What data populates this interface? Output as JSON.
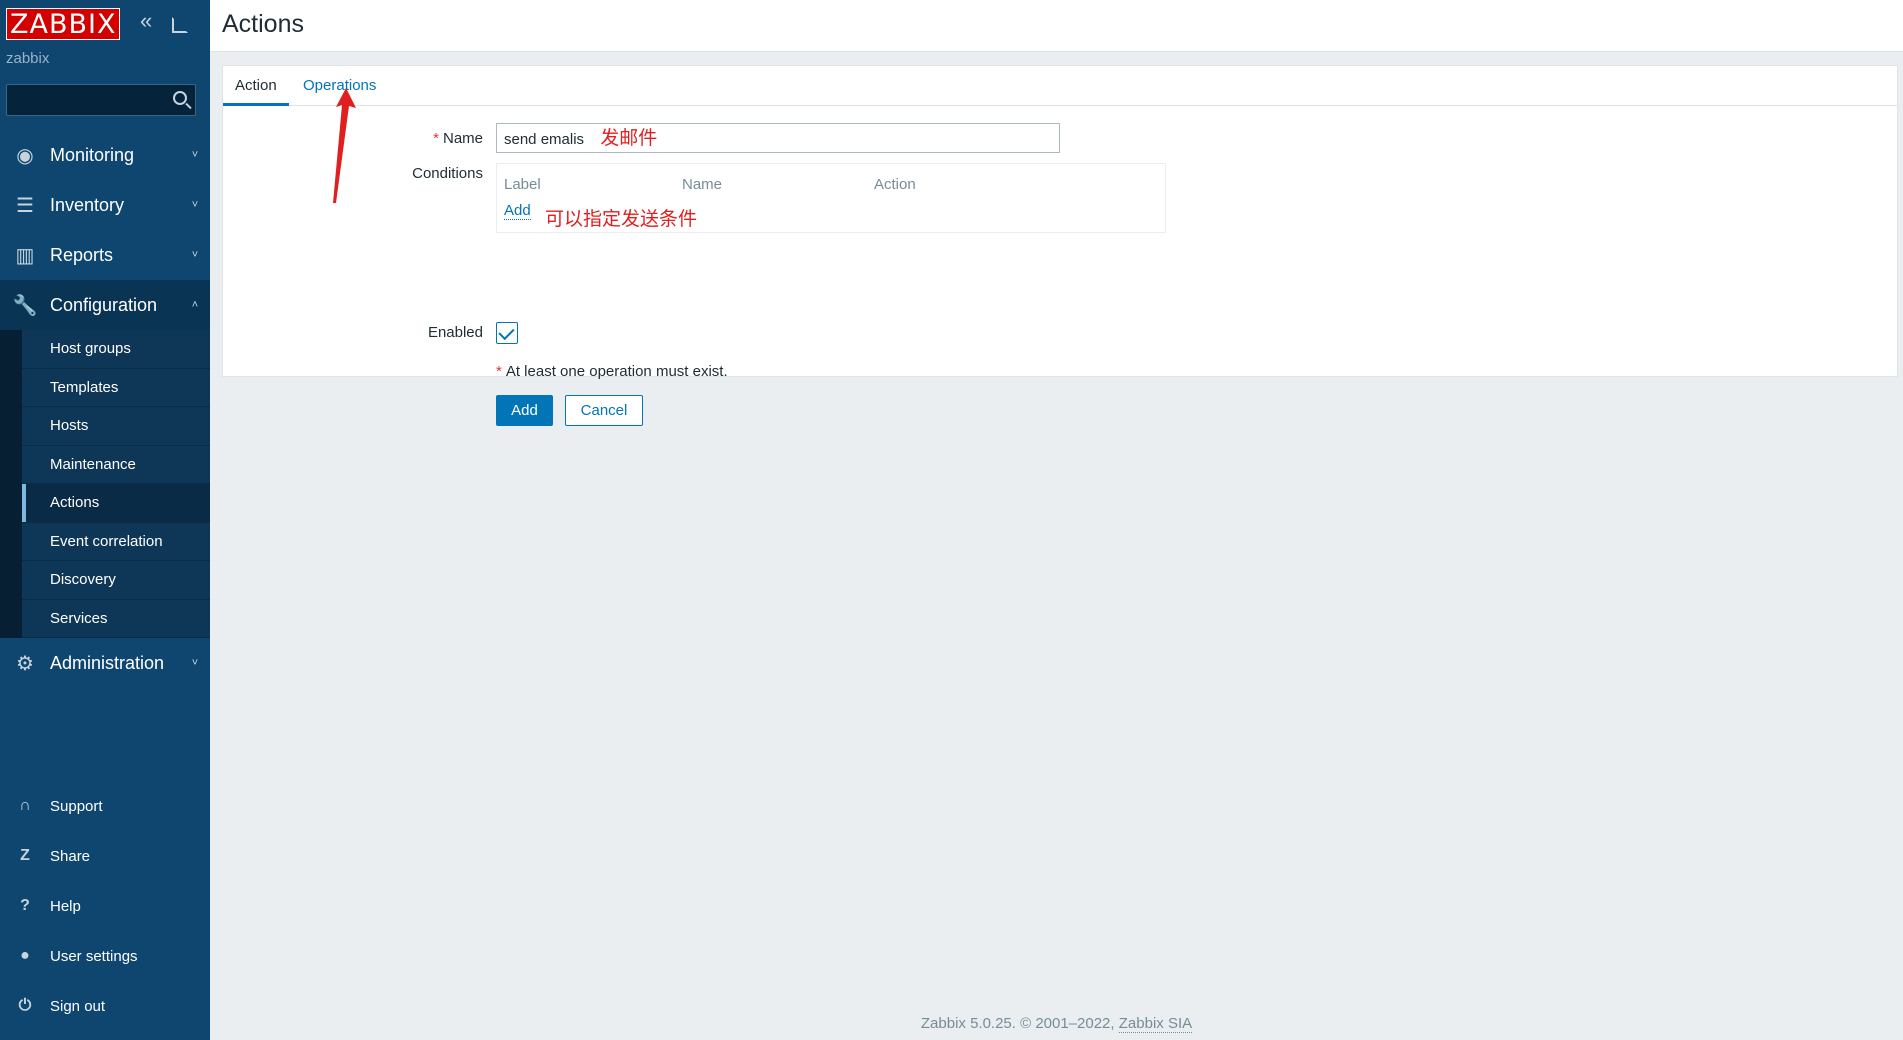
{
  "sidebar": {
    "logo": "ZABBIX",
    "server_name": "zabbix",
    "search_placeholder": "",
    "menu": [
      {
        "label": "Monitoring",
        "icon": "eye-icon"
      },
      {
        "label": "Inventory",
        "icon": "list-icon"
      },
      {
        "label": "Reports",
        "icon": "bar-chart-icon"
      },
      {
        "label": "Configuration",
        "icon": "wrench-icon"
      },
      {
        "label": "Administration",
        "icon": "gear-icon"
      }
    ],
    "config_submenu": [
      "Host groups",
      "Templates",
      "Hosts",
      "Maintenance",
      "Actions",
      "Event correlation",
      "Discovery",
      "Services"
    ],
    "bottom": [
      {
        "label": "Support",
        "icon": "headset-icon"
      },
      {
        "label": "Share",
        "icon": "share-icon"
      },
      {
        "label": "Help",
        "icon": "help-icon"
      },
      {
        "label": "User settings",
        "icon": "user-icon"
      },
      {
        "label": "Sign out",
        "icon": "power-icon"
      }
    ]
  },
  "page": {
    "title": "Actions"
  },
  "tabs": [
    "Action",
    "Operations"
  ],
  "form": {
    "name_label": "Name",
    "name_value": "send emalis",
    "name_note": "发邮件",
    "conditions_label": "Conditions",
    "conditions_headers": [
      "Label",
      "Name",
      "Action"
    ],
    "conditions_add": "Add",
    "conditions_note": "可以指定发送条件",
    "enabled_label": "Enabled",
    "enabled": true,
    "warning": "At least one operation must exist.",
    "add_button": "Add",
    "cancel_button": "Cancel"
  },
  "footer": {
    "text": "Zabbix 5.0.25. © 2001–2022, ",
    "link": "Zabbix SIA"
  },
  "colors": {
    "sidebar_bg": "#0e4670",
    "accent": "#0275b8",
    "logo_red": "#d40000",
    "annotation_red": "#e02020"
  }
}
